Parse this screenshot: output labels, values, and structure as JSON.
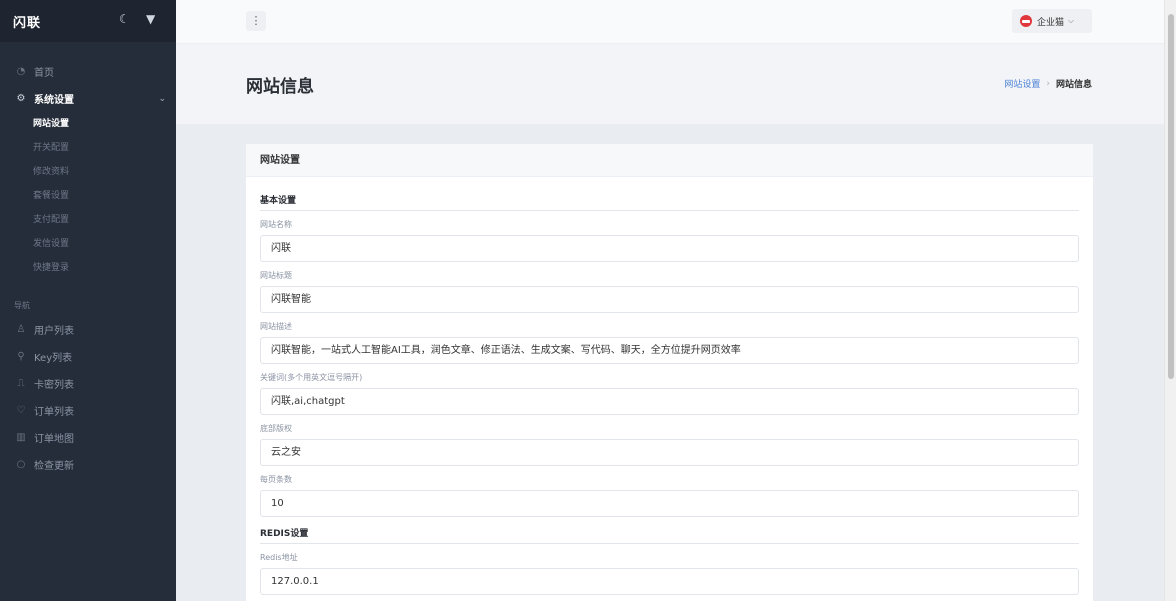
{
  "sidebar": {
    "brand": "闪联",
    "top_icons": [
      "moon-icon",
      "pin-icon"
    ],
    "home": {
      "label": "首页",
      "icon": "home-icon"
    },
    "system": {
      "label": "系统设置",
      "icon": "settings-icon",
      "items": [
        {
          "label": "网站设置",
          "current": true
        },
        {
          "label": "开关配置"
        },
        {
          "label": "修改资料"
        },
        {
          "label": "套餐设置"
        },
        {
          "label": "支付配置"
        },
        {
          "label": "发信设置"
        },
        {
          "label": "快捷登录"
        }
      ]
    },
    "nav_caption": "导航",
    "nav": [
      {
        "label": "用户列表",
        "icon": "users-icon"
      },
      {
        "label": "Key列表",
        "icon": "key-icon"
      },
      {
        "label": "卡密列表",
        "icon": "card-icon"
      },
      {
        "label": "订单列表",
        "icon": "heart-icon"
      },
      {
        "label": "订单地图",
        "icon": "map-icon"
      },
      {
        "label": "检查更新",
        "icon": "refresh-icon"
      }
    ]
  },
  "topbar": {
    "user_name": "企业猫"
  },
  "header": {
    "title": "网站信息",
    "breadcrumb_parent": "网站设置",
    "breadcrumb_current": "网站信息"
  },
  "card": {
    "title": "网站设置",
    "basic_title": "基本设置",
    "fields": {
      "site_name": {
        "label": "网站名称",
        "value": "闪联"
      },
      "site_title": {
        "label": "网站标题",
        "value": "闪联智能"
      },
      "site_desc": {
        "label": "网站描述",
        "value": "闪联智能，一站式人工智能AI工具，润色文章、修正语法、生成文案、写代码、聊天，全方位提升网页效率"
      },
      "keywords": {
        "label": "关键词(多个用英文逗号隔开)",
        "value": "闪联,ai,chatgpt"
      },
      "copyright": {
        "label": "底部版权",
        "value": "云之安"
      },
      "page_size": {
        "label": "每页条数",
        "value": "10"
      }
    },
    "redis_title": "REDIS设置",
    "redis": {
      "address": {
        "label": "Redis地址",
        "value": "127.0.0.1"
      }
    }
  },
  "colors": {
    "sidebar_bg": "#252d3a",
    "sidebar_head_bg": "#1e2530",
    "accent_link": "#4a7fd6",
    "avatar_red": "#e0373c"
  }
}
